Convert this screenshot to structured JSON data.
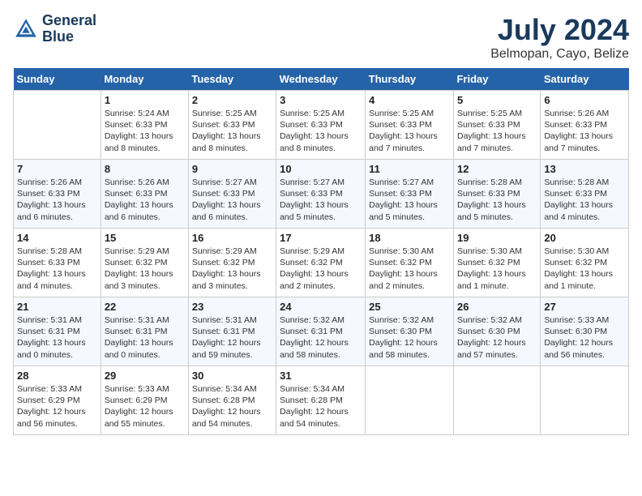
{
  "header": {
    "logo_line1": "General",
    "logo_line2": "Blue",
    "month_year": "July 2024",
    "location": "Belmopan, Cayo, Belize"
  },
  "days_of_week": [
    "Sunday",
    "Monday",
    "Tuesday",
    "Wednesday",
    "Thursday",
    "Friday",
    "Saturday"
  ],
  "weeks": [
    [
      {
        "day": "",
        "info": ""
      },
      {
        "day": "1",
        "info": "Sunrise: 5:24 AM\nSunset: 6:33 PM\nDaylight: 13 hours\nand 8 minutes."
      },
      {
        "day": "2",
        "info": "Sunrise: 5:25 AM\nSunset: 6:33 PM\nDaylight: 13 hours\nand 8 minutes."
      },
      {
        "day": "3",
        "info": "Sunrise: 5:25 AM\nSunset: 6:33 PM\nDaylight: 13 hours\nand 8 minutes."
      },
      {
        "day": "4",
        "info": "Sunrise: 5:25 AM\nSunset: 6:33 PM\nDaylight: 13 hours\nand 7 minutes."
      },
      {
        "day": "5",
        "info": "Sunrise: 5:25 AM\nSunset: 6:33 PM\nDaylight: 13 hours\nand 7 minutes."
      },
      {
        "day": "6",
        "info": "Sunrise: 5:26 AM\nSunset: 6:33 PM\nDaylight: 13 hours\nand 7 minutes."
      }
    ],
    [
      {
        "day": "7",
        "info": "Sunrise: 5:26 AM\nSunset: 6:33 PM\nDaylight: 13 hours\nand 6 minutes."
      },
      {
        "day": "8",
        "info": "Sunrise: 5:26 AM\nSunset: 6:33 PM\nDaylight: 13 hours\nand 6 minutes."
      },
      {
        "day": "9",
        "info": "Sunrise: 5:27 AM\nSunset: 6:33 PM\nDaylight: 13 hours\nand 6 minutes."
      },
      {
        "day": "10",
        "info": "Sunrise: 5:27 AM\nSunset: 6:33 PM\nDaylight: 13 hours\nand 5 minutes."
      },
      {
        "day": "11",
        "info": "Sunrise: 5:27 AM\nSunset: 6:33 PM\nDaylight: 13 hours\nand 5 minutes."
      },
      {
        "day": "12",
        "info": "Sunrise: 5:28 AM\nSunset: 6:33 PM\nDaylight: 13 hours\nand 5 minutes."
      },
      {
        "day": "13",
        "info": "Sunrise: 5:28 AM\nSunset: 6:33 PM\nDaylight: 13 hours\nand 4 minutes."
      }
    ],
    [
      {
        "day": "14",
        "info": "Sunrise: 5:28 AM\nSunset: 6:33 PM\nDaylight: 13 hours\nand 4 minutes."
      },
      {
        "day": "15",
        "info": "Sunrise: 5:29 AM\nSunset: 6:32 PM\nDaylight: 13 hours\nand 3 minutes."
      },
      {
        "day": "16",
        "info": "Sunrise: 5:29 AM\nSunset: 6:32 PM\nDaylight: 13 hours\nand 3 minutes."
      },
      {
        "day": "17",
        "info": "Sunrise: 5:29 AM\nSunset: 6:32 PM\nDaylight: 13 hours\nand 2 minutes."
      },
      {
        "day": "18",
        "info": "Sunrise: 5:30 AM\nSunset: 6:32 PM\nDaylight: 13 hours\nand 2 minutes."
      },
      {
        "day": "19",
        "info": "Sunrise: 5:30 AM\nSunset: 6:32 PM\nDaylight: 13 hours\nand 1 minute."
      },
      {
        "day": "20",
        "info": "Sunrise: 5:30 AM\nSunset: 6:32 PM\nDaylight: 13 hours\nand 1 minute."
      }
    ],
    [
      {
        "day": "21",
        "info": "Sunrise: 5:31 AM\nSunset: 6:31 PM\nDaylight: 13 hours\nand 0 minutes."
      },
      {
        "day": "22",
        "info": "Sunrise: 5:31 AM\nSunset: 6:31 PM\nDaylight: 13 hours\nand 0 minutes."
      },
      {
        "day": "23",
        "info": "Sunrise: 5:31 AM\nSunset: 6:31 PM\nDaylight: 12 hours\nand 59 minutes."
      },
      {
        "day": "24",
        "info": "Sunrise: 5:32 AM\nSunset: 6:31 PM\nDaylight: 12 hours\nand 58 minutes."
      },
      {
        "day": "25",
        "info": "Sunrise: 5:32 AM\nSunset: 6:30 PM\nDaylight: 12 hours\nand 58 minutes."
      },
      {
        "day": "26",
        "info": "Sunrise: 5:32 AM\nSunset: 6:30 PM\nDaylight: 12 hours\nand 57 minutes."
      },
      {
        "day": "27",
        "info": "Sunrise: 5:33 AM\nSunset: 6:30 PM\nDaylight: 12 hours\nand 56 minutes."
      }
    ],
    [
      {
        "day": "28",
        "info": "Sunrise: 5:33 AM\nSunset: 6:29 PM\nDaylight: 12 hours\nand 56 minutes."
      },
      {
        "day": "29",
        "info": "Sunrise: 5:33 AM\nSunset: 6:29 PM\nDaylight: 12 hours\nand 55 minutes."
      },
      {
        "day": "30",
        "info": "Sunrise: 5:34 AM\nSunset: 6:28 PM\nDaylight: 12 hours\nand 54 minutes."
      },
      {
        "day": "31",
        "info": "Sunrise: 5:34 AM\nSunset: 6:28 PM\nDaylight: 12 hours\nand 54 minutes."
      },
      {
        "day": "",
        "info": ""
      },
      {
        "day": "",
        "info": ""
      },
      {
        "day": "",
        "info": ""
      }
    ]
  ]
}
